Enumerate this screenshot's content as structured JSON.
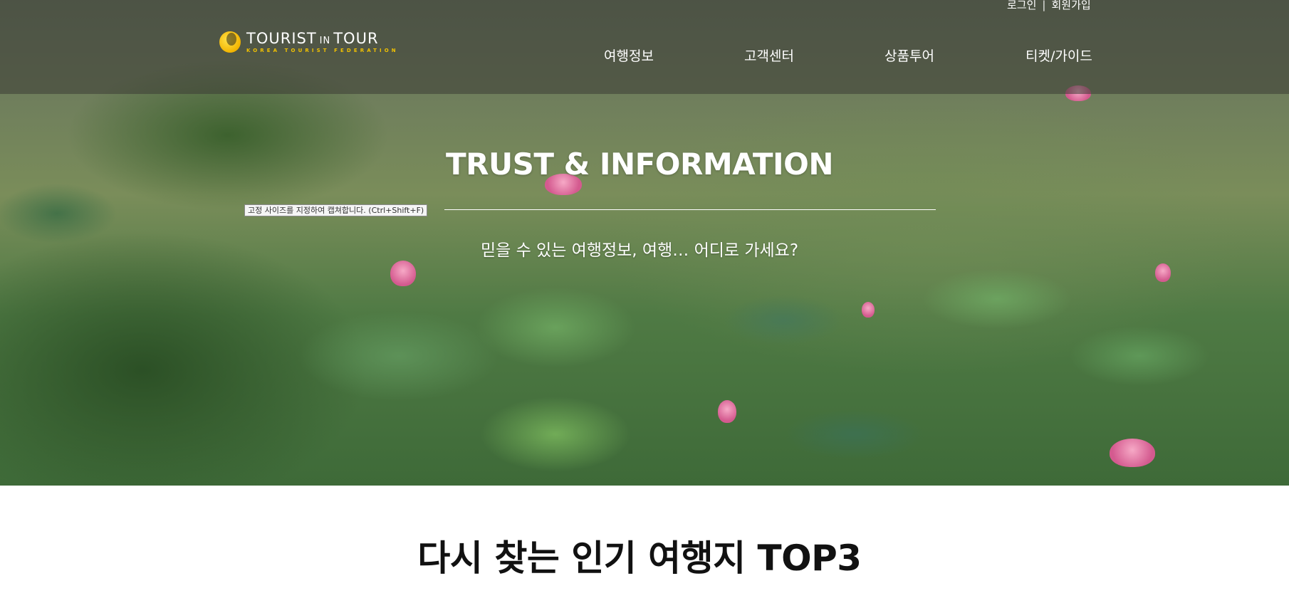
{
  "brand": {
    "name_part1": "TOURIST",
    "name_in": "IN",
    "name_part2": "TOUR",
    "tagline": "KOREA TOURIST FEDERATION",
    "accent_color": "#f2c200"
  },
  "auth": {
    "login": "로그인",
    "separator": "|",
    "signup": "회원가입"
  },
  "nav": [
    {
      "label": "여행정보"
    },
    {
      "label": "고객센터"
    },
    {
      "label": "상품투어"
    },
    {
      "label": "티켓/가이드"
    }
  ],
  "hero": {
    "title": "TRUST & INFORMATION",
    "subtitle": "믿을 수 있는 여행정보, 여행… 어디로 가세요?",
    "tooltip": "고정 사이즈를 지정하여 캡쳐합니다. (Ctrl+Shift+F)"
  },
  "section": {
    "title": "다시 찾는 인기 여행지 TOP3"
  }
}
